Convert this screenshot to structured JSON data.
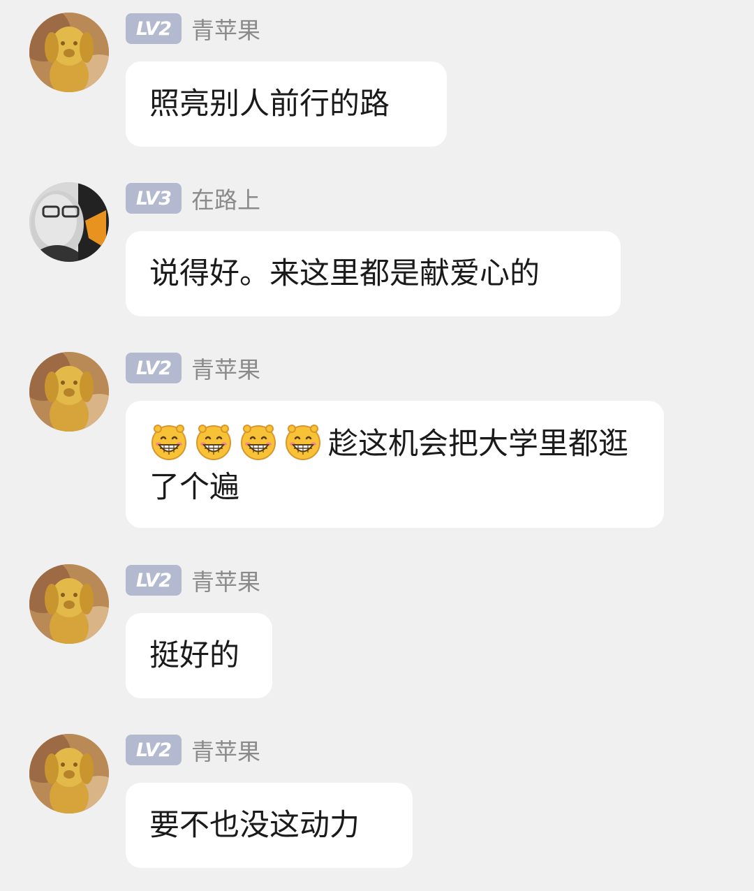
{
  "messages": [
    {
      "level": "LV2",
      "name": "青苹果",
      "avatar": "golden-dog-avatar",
      "text": "照亮别人前行的路"
    },
    {
      "level": "LV3",
      "name": "在路上",
      "avatar": "man-glasses-avatar",
      "text": "说得好。来这里都是献爱心的"
    },
    {
      "level": "LV2",
      "name": "青苹果",
      "avatar": "golden-dog-avatar",
      "emoji_count": 4,
      "emoji": "grinning-face-emoji",
      "text": "趁这机会把大学里都逛了个遍"
    },
    {
      "level": "LV2",
      "name": "青苹果",
      "avatar": "golden-dog-avatar",
      "text": "挺好的"
    },
    {
      "level": "LV2",
      "name": "青苹果",
      "avatar": "golden-dog-avatar",
      "text": "要不也没这动力"
    }
  ],
  "colors": {
    "background": "#f0f0f0",
    "bubble": "#ffffff",
    "level_badge": "#b3b9cf",
    "username": "#8a8a8a",
    "message_text": "#1a1a1a"
  }
}
